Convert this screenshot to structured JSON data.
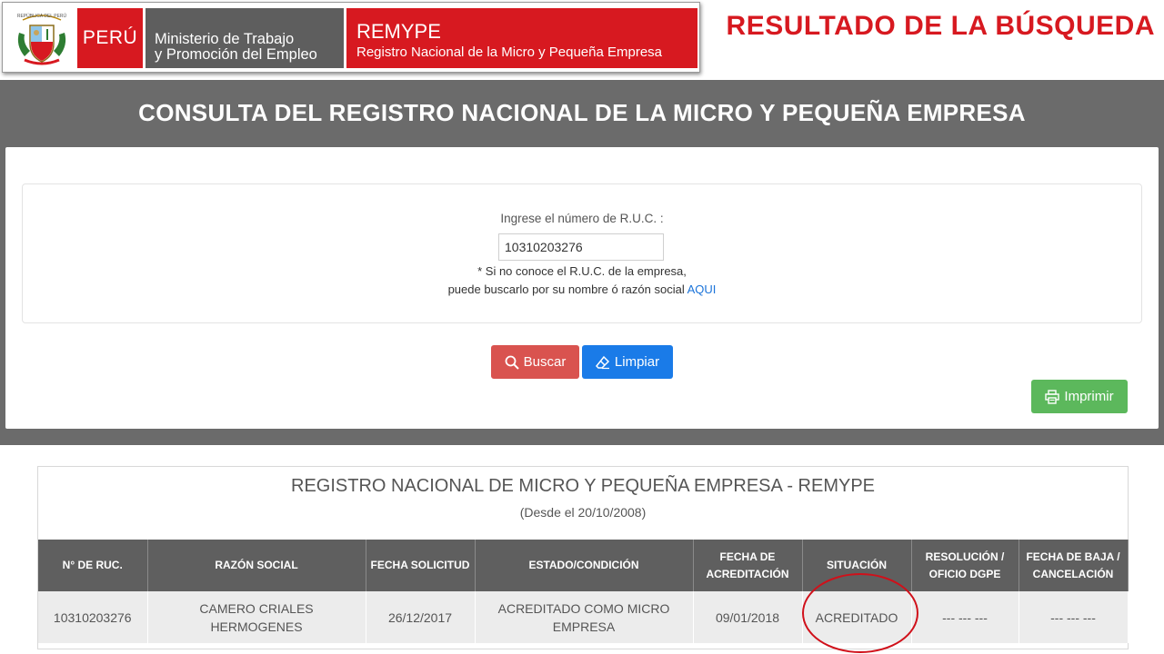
{
  "banner": {
    "crest_text": "REPÚBLICA DEL PERÚ",
    "peru": "PERÚ",
    "ministerio_line1": "Ministerio de Trabajo",
    "ministerio_line2": "y Promoción del Empleo",
    "remype_title": "REMYPE",
    "remype_subtitle": "Registro Nacional de la Micro y Pequeña Empresa"
  },
  "result_title": "RESULTADO DE LA BÚSQUEDA",
  "consulta": {
    "header": "CONSULTA DEL REGISTRO NACIONAL DE LA MICRO Y PEQUEÑA EMPRESA",
    "ruc_label": "Ingrese el número de R.U.C. :",
    "ruc_value": "10310203276",
    "hint_line1": "* Si no conoce el R.U.C. de la empresa,",
    "hint_line2_prefix": "puede buscarlo por su nombre ó razón social",
    "hint_link": "AQUI",
    "buscar_label": "Buscar",
    "limpiar_label": "Limpiar",
    "imprimir_label": "Imprimir"
  },
  "results": {
    "title": "REGISTRO NACIONAL DE MICRO Y PEQUEÑA EMPRESA - REMYPE",
    "subtitle": "(Desde el 20/10/2008)",
    "columns": [
      "N° DE RUC.",
      "RAZÓN SOCIAL",
      "FECHA SOLICITUD",
      "ESTADO/CONDICIÓN",
      "FECHA DE ACREDITACIÓN",
      "SITUACIÓN",
      "RESOLUCIÓN / OFICIO DGPE",
      "FECHA DE BAJA / CANCELACIÓN"
    ],
    "rows": [
      {
        "ruc": "10310203276",
        "razon_social": "CAMERO CRIALES HERMOGENES",
        "fecha_solicitud": "26/12/2017",
        "estado": "ACREDITADO COMO MICRO EMPRESA",
        "fecha_acreditacion": "09/01/2018",
        "situacion": "ACREDITADO",
        "resolucion": "--- --- ---",
        "fecha_baja": "--- --- ---"
      }
    ]
  },
  "colors": {
    "brand_red": "#d71920",
    "ministry_gray": "#5e5e5e",
    "header_gray": "#6b6b6b",
    "buscar": "#d9534f",
    "limpiar": "#1a7be8",
    "imprimir": "#5cb85c",
    "link": "#1a73d9"
  },
  "icons": {
    "crest": "coat-of-arms-icon",
    "buscar": "search-icon",
    "limpiar": "eraser-icon",
    "imprimir": "printer-icon"
  }
}
